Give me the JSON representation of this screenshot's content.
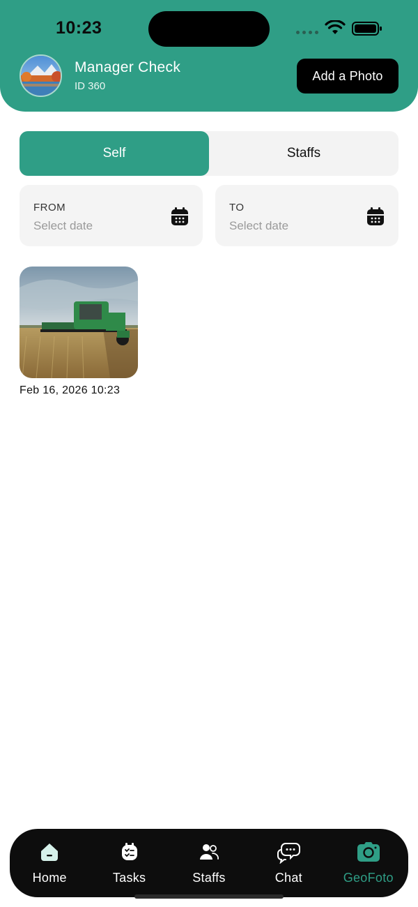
{
  "status_bar": {
    "time": "10:23"
  },
  "header": {
    "name": "Manager Check",
    "id_text": "ID 360",
    "add_photo_label": "Add a Photo"
  },
  "segments": [
    {
      "label": "Self",
      "active": true
    },
    {
      "label": "Staffs",
      "active": false
    }
  ],
  "date_filter": {
    "from_label": "FROM",
    "from_placeholder": "Select date",
    "to_label": "TO",
    "to_placeholder": "Select date"
  },
  "photos": [
    {
      "caption": "Feb 16, 2026 10:23"
    }
  ],
  "tabbar": {
    "items": [
      {
        "label": "Home",
        "icon": "home-icon"
      },
      {
        "label": "Tasks",
        "icon": "tasks-icon"
      },
      {
        "label": "Staffs",
        "icon": "staffs-icon"
      },
      {
        "label": "Chat",
        "icon": "chat-icon"
      },
      {
        "label": "GeoFoto",
        "icon": "camera-icon",
        "active": true
      }
    ]
  },
  "colors": {
    "accent": "#2f9e86",
    "tabbar_bg": "#0d0d0d",
    "field_bg": "#f4f4f4"
  }
}
